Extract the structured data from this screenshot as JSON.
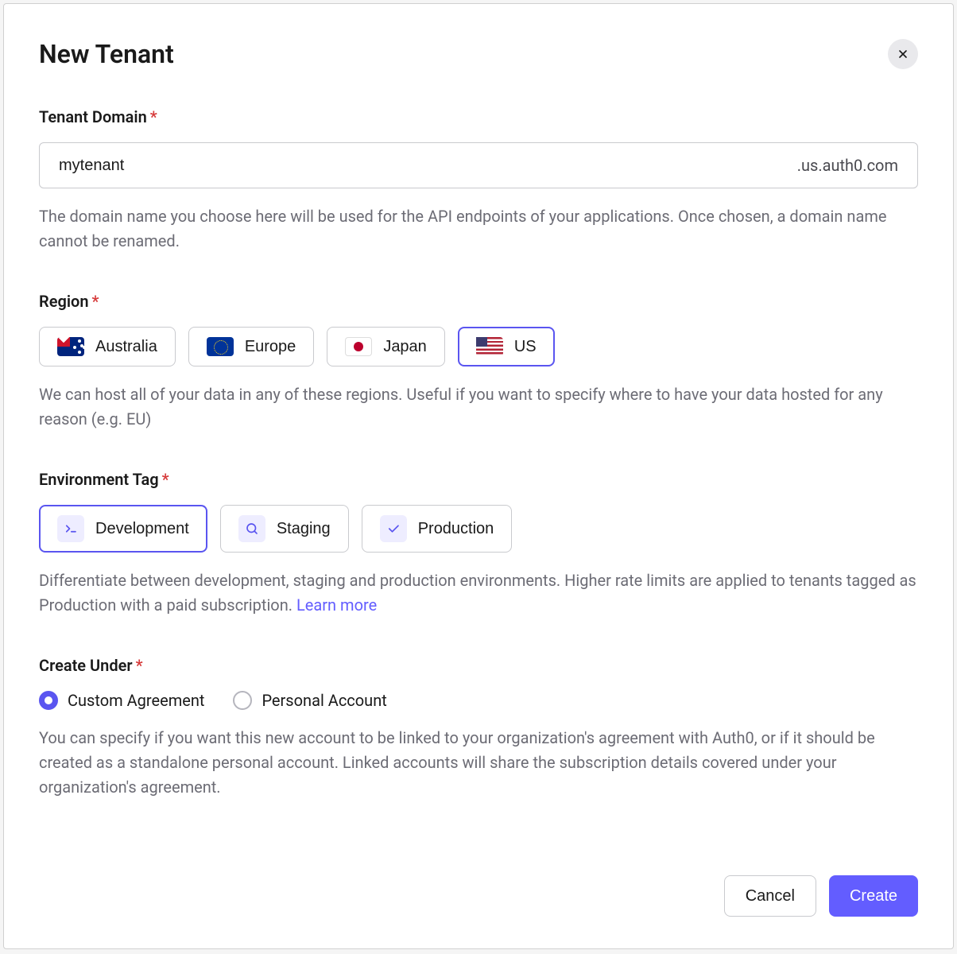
{
  "modal": {
    "title": "New Tenant"
  },
  "tenantDomain": {
    "label": "Tenant Domain",
    "value": "mytenant",
    "suffix": ".us.auth0.com",
    "help": "The domain name you choose here will be used for the API endpoints of your applications. Once chosen, a domain name cannot be renamed."
  },
  "region": {
    "label": "Region",
    "options": [
      {
        "id": "au",
        "label": "Australia",
        "selected": false
      },
      {
        "id": "eu",
        "label": "Europe",
        "selected": false
      },
      {
        "id": "jp",
        "label": "Japan",
        "selected": false
      },
      {
        "id": "us",
        "label": "US",
        "selected": true
      }
    ],
    "help": "We can host all of your data in any of these regions. Useful if you want to specify where to have your data hosted for any reason (e.g. EU)"
  },
  "environment": {
    "label": "Environment Tag",
    "options": [
      {
        "id": "dev",
        "label": "Development",
        "icon": "terminal-icon",
        "selected": true
      },
      {
        "id": "staging",
        "label": "Staging",
        "icon": "search-icon",
        "selected": false
      },
      {
        "id": "prod",
        "label": "Production",
        "icon": "check-icon",
        "selected": false
      }
    ],
    "help": "Differentiate between development, staging and production environments. Higher rate limits are applied to tenants tagged as Production with a paid subscription. ",
    "learnMore": "Learn more"
  },
  "createUnder": {
    "label": "Create Under",
    "options": [
      {
        "id": "custom",
        "label": "Custom Agreement",
        "checked": true
      },
      {
        "id": "personal",
        "label": "Personal Account",
        "checked": false
      }
    ],
    "help": "You can specify if you want this new account to be linked to your organization's agreement with Auth0, or if it should be created as a standalone personal account. Linked accounts will share the subscription details covered under your organization's agreement."
  },
  "actions": {
    "cancel": "Cancel",
    "create": "Create"
  }
}
